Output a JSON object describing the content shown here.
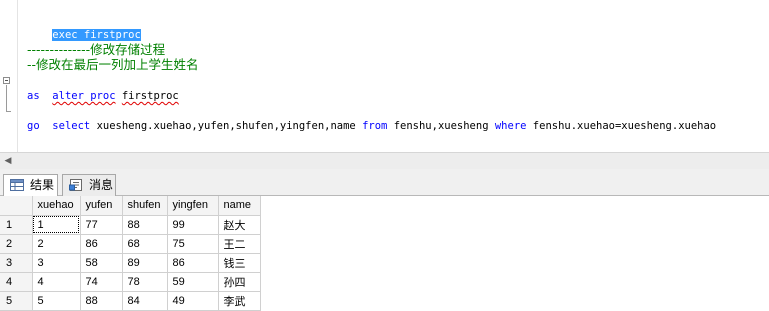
{
  "editor": {
    "line1": "exec firstproc",
    "line2": "--------------修改存储过程",
    "line3": "--修改在最后一列加上学生姓名",
    "line4_kw": "alter proc",
    "line4_name": "firstproc",
    "line5": "as",
    "line6_select": "select",
    "line6_cols": "xuesheng.xuehao,yufen,shufen,yingfen,name",
    "line6_from": "from",
    "line6_tables": "fenshu,xuesheng",
    "line6_where": "where",
    "line6_cond": "fenshu.xuehao=xuesheng.xuehao",
    "line7": "go"
  },
  "tabs": {
    "results_label": "结果",
    "messages_label": "消息"
  },
  "grid": {
    "columns": [
      "xuehao",
      "yufen",
      "shufen",
      "yingfen",
      "name"
    ],
    "rows": [
      {
        "num": "1",
        "cells": [
          "1",
          "77",
          "88",
          "99",
          "赵大"
        ]
      },
      {
        "num": "2",
        "cells": [
          "2",
          "86",
          "68",
          "75",
          "王二"
        ]
      },
      {
        "num": "3",
        "cells": [
          "3",
          "58",
          "89",
          "86",
          "钱三"
        ]
      },
      {
        "num": "4",
        "cells": [
          "4",
          "74",
          "78",
          "59",
          "孙四"
        ]
      },
      {
        "num": "5",
        "cells": [
          "5",
          "88",
          "84",
          "49",
          "李武"
        ]
      }
    ]
  },
  "colors": {
    "keyword": "#0000ff",
    "comment": "#008000",
    "selection": "#3399ff",
    "error_squiggle": "#e00000"
  }
}
